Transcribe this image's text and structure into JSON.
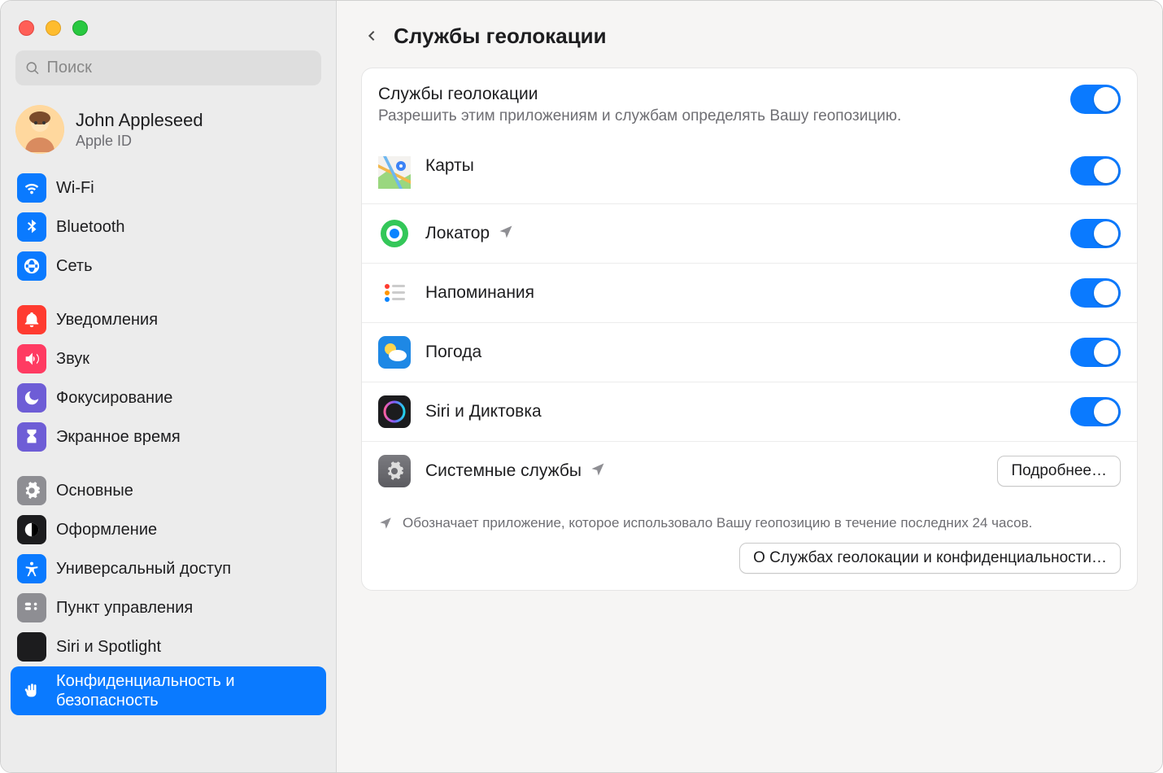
{
  "window": {
    "title": "Службы геолокации"
  },
  "search": {
    "placeholder": "Поиск"
  },
  "account": {
    "name": "John Appleseed",
    "sub": "Apple ID"
  },
  "sidebar": {
    "groups": [
      {
        "items": [
          {
            "id": "wifi",
            "label": "Wi-Fi",
            "icon": "wifi",
            "bg": "#0a7aff"
          },
          {
            "id": "bluetooth",
            "label": "Bluetooth",
            "icon": "bluetooth",
            "bg": "#0a7aff"
          },
          {
            "id": "network",
            "label": "Сеть",
            "icon": "globe",
            "bg": "#0a7aff"
          }
        ]
      },
      {
        "items": [
          {
            "id": "notifications",
            "label": "Уведомления",
            "icon": "bell",
            "bg": "#ff3b30"
          },
          {
            "id": "sound",
            "label": "Звук",
            "icon": "speaker",
            "bg": "#ff3b62"
          },
          {
            "id": "focus",
            "label": "Фокусирование",
            "icon": "moon",
            "bg": "#6e5dd6"
          },
          {
            "id": "screentime",
            "label": "Экранное время",
            "icon": "hourglass",
            "bg": "#6e5dd6"
          }
        ]
      },
      {
        "items": [
          {
            "id": "general",
            "label": "Основные",
            "icon": "gear",
            "bg": "#8e8e93"
          },
          {
            "id": "appearance",
            "label": "Оформление",
            "icon": "appearance",
            "bg": "#1c1c1e"
          },
          {
            "id": "accessibility",
            "label": "Универсальный доступ",
            "icon": "accessibility",
            "bg": "#0a7aff"
          },
          {
            "id": "controlcenter",
            "label": "Пункт управления",
            "icon": "controlcenter",
            "bg": "#8e8e93"
          },
          {
            "id": "siri",
            "label": "Siri и Spotlight",
            "icon": "siri",
            "bg": "#1c1c1e"
          },
          {
            "id": "privacy",
            "label": "Конфиденциальность и безопасность",
            "icon": "hand",
            "bg": "#0a7aff",
            "selected": true
          }
        ]
      }
    ]
  },
  "header": {
    "title": "Службы геолокации",
    "subtitle": "Разрешить этим приложениям и службам определять Вашу геопозицию."
  },
  "apps": [
    {
      "id": "maps",
      "label": "Карты",
      "toggle": true,
      "arrow": false
    },
    {
      "id": "findmy",
      "label": "Локатор",
      "toggle": true,
      "arrow": true
    },
    {
      "id": "reminders",
      "label": "Напоминания",
      "toggle": true,
      "arrow": false
    },
    {
      "id": "weather",
      "label": "Погода",
      "toggle": true,
      "arrow": false
    },
    {
      "id": "siri",
      "label": "Siri и Диктовка",
      "toggle": true,
      "arrow": false
    }
  ],
  "system": {
    "label": "Системные службы",
    "button": "Подробнее…",
    "arrow": true
  },
  "footnote": "Обозначает приложение, которое использовало Вашу геопозицию в течение последних 24 часов.",
  "about_button": "О Службах геолокации и конфиденциальности…",
  "master_toggle": true
}
